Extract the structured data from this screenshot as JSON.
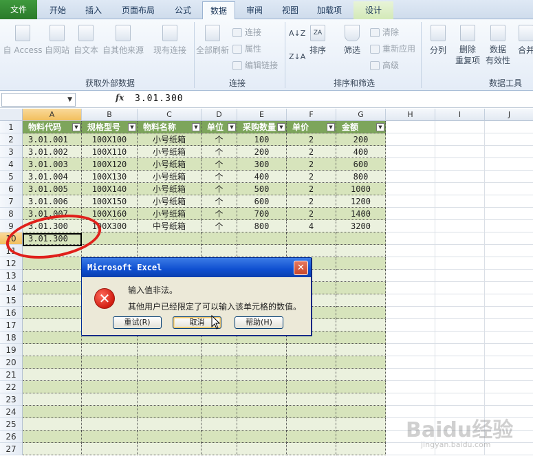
{
  "ribbon_tabs": [
    "文件",
    "开始",
    "插入",
    "页面布局",
    "公式",
    "数据",
    "审阅",
    "视图",
    "加载项",
    "设计"
  ],
  "ribbon": {
    "get_external": [
      "自 Access",
      "自网站",
      "自文本",
      "自其他来源",
      "现有连接"
    ],
    "refresh_all": "全部刷新",
    "connections_small": [
      "连接",
      "属性",
      "编辑链接"
    ],
    "sort": "排序",
    "filter": "筛选",
    "filter_small": [
      "清除",
      "重新应用",
      "高级"
    ],
    "tools": [
      "分列",
      "删除\n重复项",
      "数据\n有效性",
      "合并"
    ],
    "groups": [
      "获取外部数据",
      "连接",
      "排序和筛选",
      "数据工具"
    ],
    "sort_az": "A↓Z",
    "sort_za": "Z↓A",
    "sort_icon_text": "ZA"
  },
  "formula_bar": {
    "name_box": "",
    "fx": "fx",
    "value": "3.01.300"
  },
  "columns": [
    "A",
    "B",
    "C",
    "D",
    "E",
    "F",
    "G",
    "H",
    "I",
    "J"
  ],
  "table": {
    "headers": [
      "物料代码",
      "规格型号",
      "物料名称",
      "单位",
      "采购数量",
      "单价",
      "金额"
    ],
    "rows": [
      [
        "3.01.001",
        "100X100",
        "小号纸箱",
        "个",
        "100",
        "2",
        "200"
      ],
      [
        "3.01.002",
        "100X110",
        "小号纸箱",
        "个",
        "200",
        "2",
        "400"
      ],
      [
        "3.01.003",
        "100X120",
        "小号纸箱",
        "个",
        "300",
        "2",
        "600"
      ],
      [
        "3.01.004",
        "100X130",
        "小号纸箱",
        "个",
        "400",
        "2",
        "800"
      ],
      [
        "3.01.005",
        "100X140",
        "小号纸箱",
        "个",
        "500",
        "2",
        "1000"
      ],
      [
        "3.01.006",
        "100X150",
        "小号纸箱",
        "个",
        "600",
        "2",
        "1200"
      ],
      [
        "3.01.007",
        "100X160",
        "小号纸箱",
        "个",
        "700",
        "2",
        "1400"
      ],
      [
        "3.01.300",
        "100X300",
        "中号纸箱",
        "个",
        "800",
        "4",
        "3200"
      ],
      [
        "3.01.300",
        "",
        "",
        "",
        "",
        "",
        ""
      ]
    ]
  },
  "row_numbers": [
    "1",
    "2",
    "3",
    "4",
    "5",
    "6",
    "7",
    "8",
    "9",
    "10",
    "11",
    "12",
    "13",
    "14",
    "15",
    "16",
    "17",
    "18",
    "19",
    "20",
    "21",
    "22",
    "23",
    "24",
    "25",
    "26",
    "27"
  ],
  "dialog": {
    "title": "Microsoft Excel",
    "close": "✕",
    "icon": "✕",
    "message_line1": "输入值非法。",
    "message_line2": "其他用户已经限定了可以输入该单元格的数值。",
    "buttons": [
      "重试(R)",
      "取消",
      "帮助(H)"
    ]
  },
  "watermark": {
    "brand": "Baidu经验",
    "url": "jingyan.baidu.com"
  },
  "colors": {
    "header_green": "#7da55b",
    "band_dark": "#d7e4bc",
    "band_light": "#ebf1de",
    "highlight_red": "#e0201b"
  }
}
